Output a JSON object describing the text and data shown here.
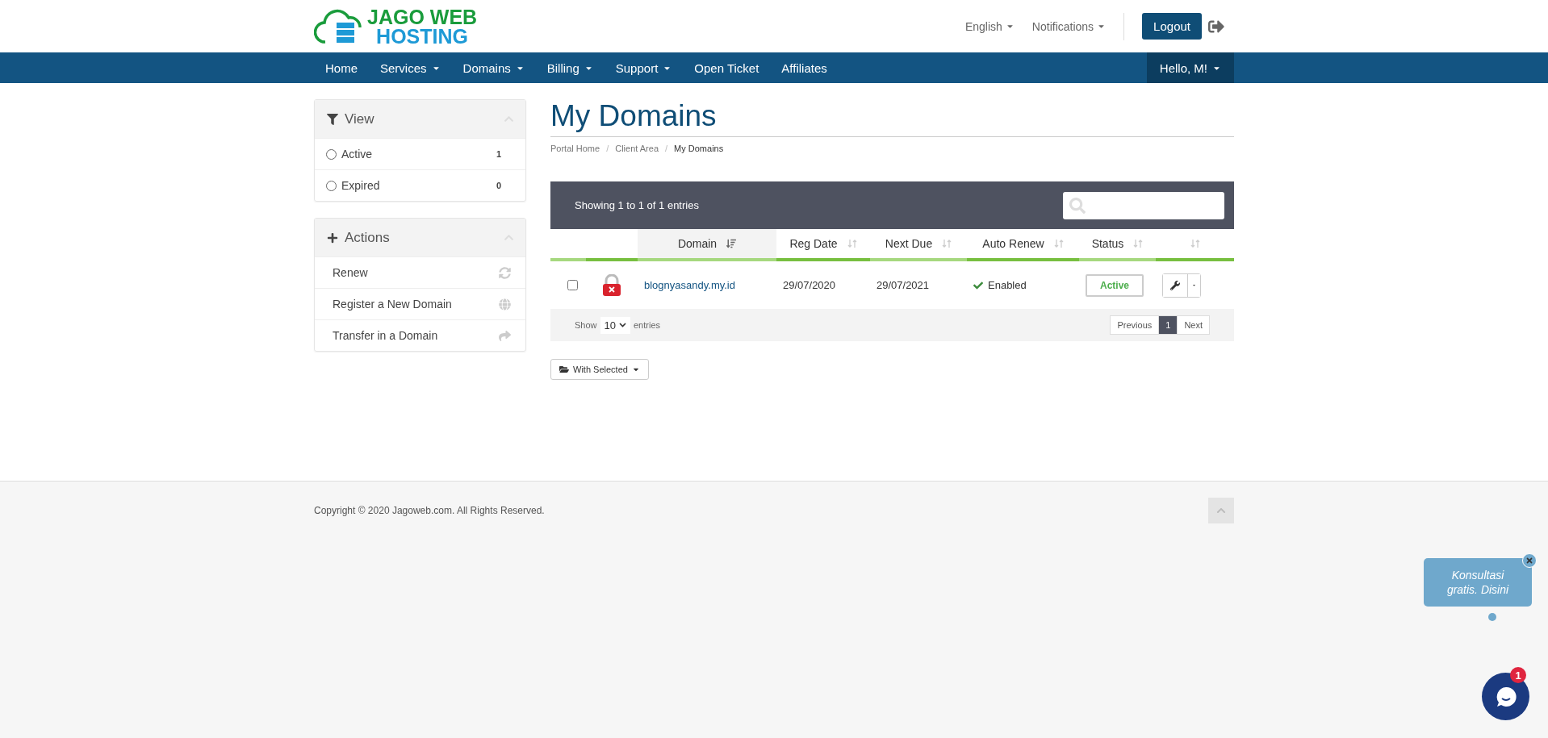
{
  "logo": {
    "line1": "JAGO WEB",
    "line2": "HOSTING"
  },
  "top_links": [
    {
      "label": "English",
      "dropdown": true
    },
    {
      "label": "Notifications",
      "dropdown": true
    }
  ],
  "logout": "Logout",
  "nav": [
    {
      "label": "Home",
      "dropdown": false
    },
    {
      "label": "Services",
      "dropdown": true
    },
    {
      "label": "Domains",
      "dropdown": true
    },
    {
      "label": "Billing",
      "dropdown": true
    },
    {
      "label": "Support",
      "dropdown": true
    },
    {
      "label": "Open Ticket",
      "dropdown": false
    },
    {
      "label": "Affiliates",
      "dropdown": false
    }
  ],
  "user_menu": "Hello, M!",
  "sidebar": [
    {
      "title": "View",
      "kind": "filter",
      "items": [
        {
          "label": "Active",
          "count": "1",
          "selected": false
        },
        {
          "label": "Expired",
          "count": "0",
          "selected": false
        }
      ]
    },
    {
      "title": "Actions",
      "kind": "actions",
      "items": [
        {
          "label": "Renew",
          "kind": "refresh"
        },
        {
          "label": "Register a New Domain",
          "kind": "globe"
        },
        {
          "label": "Transfer in a Domain",
          "kind": "share"
        }
      ]
    }
  ],
  "page_title": "My Domains",
  "breadcrumbs": {
    "separator": "/",
    "items": [
      {
        "label": "Portal Home",
        "current": false
      },
      {
        "label": "Client Area",
        "current": false
      },
      {
        "label": "My Domains",
        "current": true
      }
    ]
  },
  "table": {
    "info": "Showing 1 to 1 of 1 entries",
    "columns": [
      {
        "sorted": false
      },
      {
        "sorted": false
      },
      {
        "label": "Domain",
        "sorted": true
      },
      {
        "label": "Reg Date",
        "sorted": false
      },
      {
        "label": "Next Due",
        "sorted": false
      },
      {
        "label": "Auto Renew",
        "sorted": false
      },
      {
        "label": "Status",
        "sorted": false
      },
      {
        "sorted": false
      }
    ],
    "rows": [
      {
        "checked": false,
        "domain": "blognyasandy.my.id",
        "reg_date": "29/07/2020",
        "next_due": "29/07/2021",
        "auto_renew": "Enabled",
        "status": "Active"
      }
    ],
    "length": {
      "before": "Show",
      "value": "10",
      "after": "entries"
    },
    "pagination": [
      {
        "label": "Previous",
        "selected": false
      },
      {
        "label": "1",
        "selected": true
      },
      {
        "label": "Next",
        "selected": false
      }
    ]
  },
  "with_selected": "With Selected",
  "footer": "Copyright © 2020 Jagoweb.com. All Rights Reserved.",
  "chat": {
    "bubble": "Konsultasi gratis. Disini",
    "badge": "1"
  }
}
